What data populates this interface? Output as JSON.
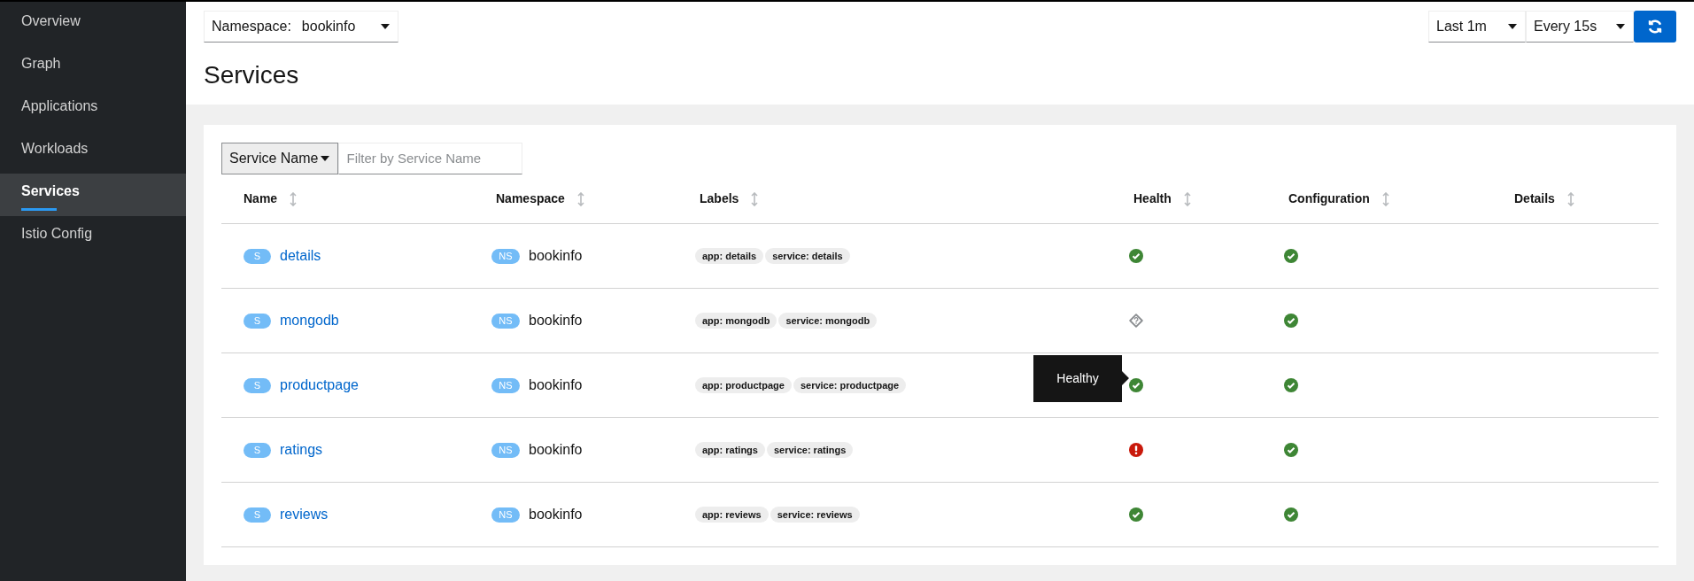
{
  "sidebar": {
    "items": [
      {
        "label": "Overview",
        "selected": false
      },
      {
        "label": "Graph",
        "selected": false
      },
      {
        "label": "Applications",
        "selected": false
      },
      {
        "label": "Workloads",
        "selected": false
      },
      {
        "label": "Services",
        "selected": true
      },
      {
        "label": "Istio Config",
        "selected": false
      }
    ]
  },
  "header": {
    "namespace_label": "Namespace:",
    "namespace_value": "bookinfo",
    "title": "Services",
    "duration": "Last 1m",
    "refresh_interval": "Every 15s"
  },
  "filter": {
    "field": "Service Name",
    "placeholder": "Filter by Service Name"
  },
  "table": {
    "columns": [
      "Name",
      "Namespace",
      "Labels",
      "Health",
      "Configuration",
      "Details"
    ],
    "rows": [
      {
        "badge": "S",
        "name": "details",
        "ns_badge": "NS",
        "namespace": "bookinfo",
        "labels": [
          "app: details",
          "service: details"
        ],
        "health": {
          "kind": "healthy"
        },
        "config": {
          "kind": "valid"
        }
      },
      {
        "badge": "S",
        "name": "mongodb",
        "ns_badge": "NS",
        "namespace": "bookinfo",
        "labels": [
          "app: mongodb",
          "service: mongodb"
        ],
        "health": {
          "kind": "unknown"
        },
        "config": {
          "kind": "valid"
        }
      },
      {
        "badge": "S",
        "name": "productpage",
        "ns_badge": "NS",
        "namespace": "bookinfo",
        "labels": [
          "app: productpage",
          "service: productpage"
        ],
        "health": {
          "kind": "healthy"
        },
        "config": {
          "kind": "valid"
        },
        "health_tooltip": "Healthy"
      },
      {
        "badge": "S",
        "name": "ratings",
        "ns_badge": "NS",
        "namespace": "bookinfo",
        "labels": [
          "app: ratings",
          "service: ratings"
        ],
        "health": {
          "kind": "failure"
        },
        "config": {
          "kind": "valid"
        }
      },
      {
        "badge": "S",
        "name": "reviews",
        "ns_badge": "NS",
        "namespace": "bookinfo",
        "labels": [
          "app: reviews",
          "service: reviews"
        ],
        "health": {
          "kind": "healthy"
        },
        "config": {
          "kind": "valid"
        }
      }
    ]
  }
}
